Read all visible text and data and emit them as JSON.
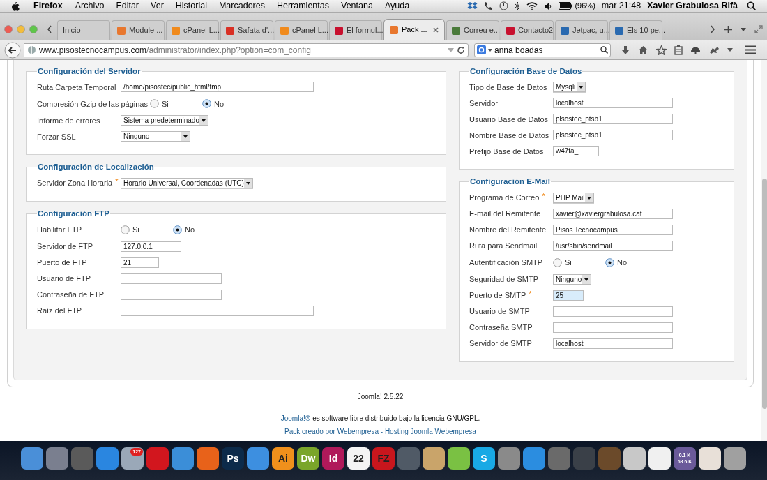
{
  "menubar": {
    "app": "Firefox",
    "menus": [
      "Archivo",
      "Editar",
      "Ver",
      "Historial",
      "Marcadores",
      "Herramientas",
      "Ventana",
      "Ayuda"
    ],
    "battery": "(96%)",
    "clock": "mar 21:48",
    "user": "Xavier Grabulosa Rifà"
  },
  "tabs": [
    {
      "label": "Inicio",
      "selected": false
    },
    {
      "label": "Module ...",
      "selected": false,
      "color": "#e8772e"
    },
    {
      "label": "cPanel L...",
      "selected": false,
      "color": "#f08a1c"
    },
    {
      "label": "Safata d'...",
      "selected": false,
      "color": "#d93025"
    },
    {
      "label": "cPanel L...",
      "selected": false,
      "color": "#f08a1c"
    },
    {
      "label": "El formul...",
      "selected": false,
      "color": "#c8102e"
    },
    {
      "label": "Pack ...",
      "selected": true,
      "color": "#e8772e"
    },
    {
      "label": "Correu e...",
      "selected": false,
      "color": "#4a7a3a"
    },
    {
      "label": "Contacto2",
      "selected": false,
      "color": "#c8102e"
    },
    {
      "label": "Jetpac, u...",
      "selected": false,
      "color": "#2a6ab0"
    },
    {
      "label": "Els 10 pe...",
      "selected": false,
      "color": "#2a6ab0"
    }
  ],
  "address": {
    "host": "www.pisostecnocampus.com",
    "path": "/administrator/index.php?option=com_config"
  },
  "search": {
    "value": "anna boadas"
  },
  "columns": [
    {
      "fieldsets": [
        {
          "title": "Configuración del Servidor",
          "fields": [
            {
              "kind": "text",
              "label": "Ruta Carpeta Temporal",
              "value": "/home/pisostec/public_html/tmp"
            },
            {
              "kind": "radio",
              "label": "Compresión Gzip de las páginas",
              "options": [
                {
                  "label": "Si",
                  "selected": false
                },
                {
                  "label": "No",
                  "selected": true
                }
              ]
            },
            {
              "kind": "select",
              "label": "Informe de errores",
              "value": "Sistema predeterminado"
            },
            {
              "kind": "select",
              "label": "Forzar SSL",
              "value": "Ninguno"
            }
          ]
        },
        {
          "title": "Configuración de Localización",
          "fields": [
            {
              "kind": "select",
              "label": "Servidor Zona Horaria",
              "required_mark": "*",
              "value": "Horario Universal, Coordenadas (UTC)"
            }
          ]
        },
        {
          "title": "Configuración FTP",
          "fields": [
            {
              "kind": "radio",
              "label": "Habilitar FTP",
              "options": [
                {
                  "label": "Si",
                  "selected": false
                },
                {
                  "label": "No",
                  "selected": true
                }
              ]
            },
            {
              "kind": "text",
              "label": "Servidor de FTP",
              "value": "127.0.0.1"
            },
            {
              "kind": "text",
              "label": "Puerto de FTP",
              "value": "21"
            },
            {
              "kind": "text",
              "label": "Usuario de FTP"
            },
            {
              "kind": "text",
              "label": "Contraseña de FTP"
            },
            {
              "kind": "text",
              "label": "Raíz del FTP"
            }
          ]
        }
      ]
    },
    {
      "fieldsets": [
        {
          "title": "Configuración Base de Datos",
          "fields": [
            {
              "kind": "select",
              "label": "Tipo de Base de Datos",
              "value": "Mysqli"
            },
            {
              "kind": "text",
              "label": "Servidor",
              "value": "localhost"
            },
            {
              "kind": "text",
              "label": "Usuario Base de Datos",
              "value": "pisostec_ptsb1"
            },
            {
              "kind": "text",
              "label": "Nombre Base de Datos",
              "value": "pisostec_ptsb1"
            },
            {
              "kind": "text",
              "label": "Prefijo Base de Datos",
              "value": "w47fa_"
            }
          ]
        },
        {
          "title": "Configuración E-Mail",
          "fields": [
            {
              "kind": "select",
              "label": "Programa de Correo",
              "required_mark": "*",
              "value": "PHP Mail"
            },
            {
              "kind": "text",
              "label": "E-mail del Remitente",
              "value": "xavier@xaviergrabulosa.cat"
            },
            {
              "kind": "text",
              "label": "Nombre del Remitente",
              "value": "Pisos Tecnocampus"
            },
            {
              "kind": "text",
              "label": "Ruta para Sendmail",
              "value": "/usr/sbin/sendmail"
            },
            {
              "kind": "radio",
              "label": "Autentificación SMTP",
              "options": [
                {
                  "label": "Si",
                  "selected": false
                },
                {
                  "label": "No",
                  "selected": true
                }
              ]
            },
            {
              "kind": "select",
              "label": "Seguridad de SMTP",
              "value": "Ninguno"
            },
            {
              "kind": "text",
              "label": "Puerto de SMTP",
              "required_mark": "*",
              "value": "25",
              "focused": true
            },
            {
              "kind": "text",
              "label": "Usuario de SMTP"
            },
            {
              "kind": "text",
              "label": "Contraseña SMTP"
            },
            {
              "kind": "text",
              "label": "Servidor de SMTP",
              "value": "localhost"
            }
          ]
        }
      ]
    }
  ],
  "footer": {
    "version": "Joomla! 2.5.22",
    "license_link": "Joomla!®",
    "license_text": "es software libre distribuido bajo la licencia GNU/GPL.",
    "credits_link": "Pack creado por Webempresa - Hosting Joomla Webempresa"
  },
  "dock": [
    {
      "color": "#4a8fd8"
    },
    {
      "color": "#7a7f8f"
    },
    {
      "color": "#5a5a5a"
    },
    {
      "color": "#2a86e0"
    },
    {
      "color": "#9aa8b8",
      "badge": "127"
    },
    {
      "color": "#d2161e"
    },
    {
      "color": "#3b8ed8"
    },
    {
      "color": "#e8621a"
    },
    {
      "color": "#0c2a4a",
      "text": "Ps"
    },
    {
      "color": "#3d8fe0"
    },
    {
      "color": "#f0901c",
      "text": "Ai"
    },
    {
      "color": "#7aa52a",
      "text": "Dw"
    },
    {
      "color": "#b0195a",
      "text": "Id"
    },
    {
      "color": "#f4f4f4",
      "text": "22"
    },
    {
      "color": "#c8161d",
      "text": "FZ"
    },
    {
      "color": "#505a66"
    },
    {
      "color": "#c9a46a"
    },
    {
      "color": "#7ac143"
    },
    {
      "color": "#19a9e5",
      "text": "S"
    },
    {
      "color": "#8a8a8a"
    },
    {
      "color": "#2b8de0"
    },
    {
      "color": "#6a6a6a"
    },
    {
      "color": "#3a4048"
    },
    {
      "color": "#6b4a2a"
    },
    {
      "color": "#c8c8c8"
    },
    {
      "color": "#f0f0f0"
    },
    {
      "color": "#6a5a9a",
      "lines": [
        "0.1 K",
        "68.6 K"
      ]
    },
    {
      "color": "#e8e0d8"
    },
    {
      "color": "#a0a0a0"
    }
  ]
}
